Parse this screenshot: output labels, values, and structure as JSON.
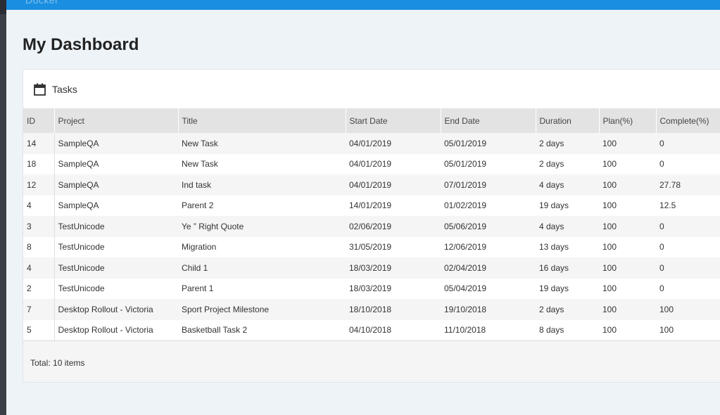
{
  "app": {
    "brand": "Docker"
  },
  "page": {
    "title": "My Dashboard"
  },
  "panel": {
    "title": "Tasks",
    "icon": "calendar-icon",
    "columns": [
      "ID",
      "Project",
      "Title",
      "Start Date",
      "End Date",
      "Duration",
      "Plan(%)",
      "Complete(%)"
    ],
    "rows": [
      [
        "14",
        "SampleQA",
        "New Task",
        "04/01/2019",
        "05/01/2019",
        "2 days",
        "100",
        "0"
      ],
      [
        "18",
        "SampleQA",
        "New Task",
        "04/01/2019",
        "05/01/2019",
        "2 days",
        "100",
        "0"
      ],
      [
        "12",
        "SampleQA",
        "Ind task",
        "04/01/2019",
        "07/01/2019",
        "4 days",
        "100",
        "27.78"
      ],
      [
        "4",
        "SampleQA",
        "Parent 2",
        "14/01/2019",
        "01/02/2019",
        "19 days",
        "100",
        "12.5"
      ],
      [
        "3",
        "TestUnicode",
        "Ye ” Right Quote",
        "02/06/2019",
        "05/06/2019",
        "4 days",
        "100",
        "0"
      ],
      [
        "8",
        "TestUnicode",
        "Migration",
        "31/05/2019",
        "12/06/2019",
        "13 days",
        "100",
        "0"
      ],
      [
        "4",
        "TestUnicode",
        "Child 1",
        "18/03/2019",
        "02/04/2019",
        "16 days",
        "100",
        "0"
      ],
      [
        "2",
        "TestUnicode",
        "Parent 1",
        "18/03/2019",
        "05/04/2019",
        "19 days",
        "100",
        "0"
      ],
      [
        "7",
        "Desktop Rollout - Victoria",
        "Sport Project Milestone",
        "18/10/2018",
        "19/10/2018",
        "2 days",
        "100",
        "100"
      ],
      [
        "5",
        "Desktop Rollout - Victoria",
        "Basketball Task 2",
        "04/10/2018",
        "11/10/2018",
        "8 days",
        "100",
        "100"
      ]
    ],
    "footer": "Total: 10 items"
  },
  "colors": {
    "topbar": "#1a8ee0",
    "header_row": "#e3e3e3",
    "background": "#eef3f7"
  }
}
